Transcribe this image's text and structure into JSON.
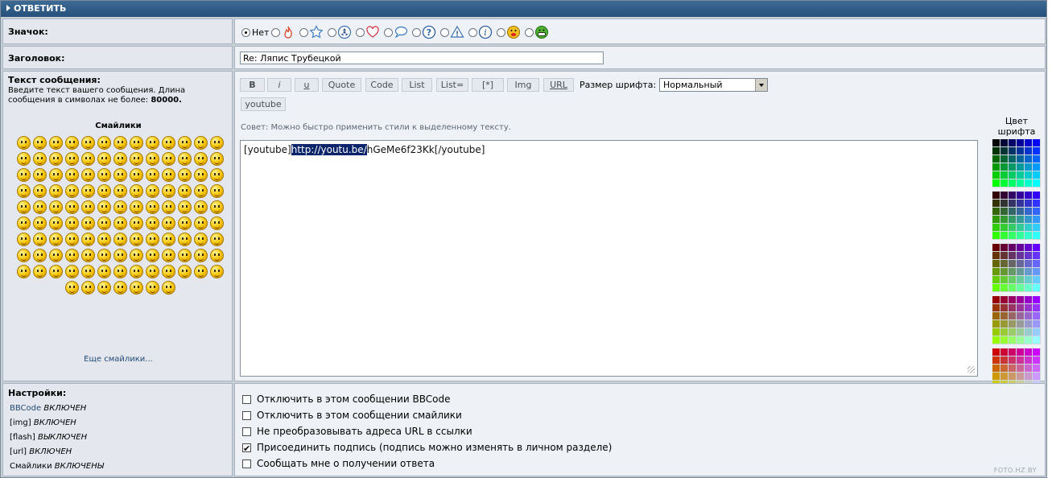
{
  "header": {
    "title": "ОТВЕТИТЬ"
  },
  "icon_row": {
    "label": "Значок:",
    "none_label": "Нет",
    "icons": [
      "fire-icon",
      "star-icon",
      "radioactive-icon",
      "heart-icon",
      "speech-bubble-icon",
      "question-icon",
      "warning-icon",
      "info-icon",
      "tongue-smiley-icon",
      "grin-smiley-icon"
    ]
  },
  "subject": {
    "label": "Заголовок:",
    "value": "Re: Ляпис Трубецкой"
  },
  "message": {
    "label": "Текст сообщения:",
    "hint_line1": "Введите текст вашего сообщения. Длина",
    "hint_line2_prefix": "сообщения в символах не более: ",
    "max_length": "80000.",
    "smilies_title": "Смайлики",
    "more_smilies": "Еще смайлики...",
    "smilies_count": 124,
    "toolbar": {
      "bold": "B",
      "italic": "i",
      "underline": "u",
      "quote": "Quote",
      "code": "Code",
      "list": "List",
      "list_eq": "List=",
      "list_item": "[*]",
      "img": "Img",
      "url": "URL",
      "youtube": "youtube",
      "font_size_label": "Размер шрифта:",
      "font_size_value": "Нормальный"
    },
    "tip": "Совет: Можно быстро применить стили к выделенному тексту.",
    "body_before": "[youtube]",
    "body_selected": "http://youtu.be/",
    "body_after": "hGeMe6f23Kk[/youtube]",
    "font_color_line1": "Цвет",
    "font_color_line2": "шрифта",
    "palette_colors": [
      [
        "#000000",
        "#000033",
        "#000066",
        "#000099",
        "#0000cc",
        "#0000ff"
      ],
      [
        "#003300",
        "#003333",
        "#003366",
        "#003399",
        "#0033cc",
        "#0033ff"
      ],
      [
        "#006600",
        "#006633",
        "#006666",
        "#006699",
        "#0066cc",
        "#0066ff"
      ],
      [
        "#009900",
        "#009933",
        "#009966",
        "#009999",
        "#0099cc",
        "#0099ff"
      ],
      [
        "#00cc00",
        "#00cc33",
        "#00cc66",
        "#00cc99",
        "#00cccc",
        "#00ccff"
      ],
      [
        "#00ff00",
        "#00ff33",
        "#00ff66",
        "#00ff99",
        "#00ffcc",
        "#00ffff"
      ],
      [
        "#330000",
        "#330033",
        "#330066",
        "#330099",
        "#3300cc",
        "#3300ff"
      ],
      [
        "#333300",
        "#333333",
        "#333366",
        "#333399",
        "#3333cc",
        "#3333ff"
      ],
      [
        "#336600",
        "#336633",
        "#336666",
        "#336699",
        "#3366cc",
        "#3366ff"
      ],
      [
        "#339900",
        "#339933",
        "#339966",
        "#339999",
        "#3399cc",
        "#3399ff"
      ],
      [
        "#33cc00",
        "#33cc33",
        "#33cc66",
        "#33cc99",
        "#33cccc",
        "#33ccff"
      ],
      [
        "#33ff00",
        "#33ff33",
        "#33ff66",
        "#33ff99",
        "#33ffcc",
        "#33ffff"
      ],
      [
        "#660000",
        "#660033",
        "#660066",
        "#660099",
        "#6600cc",
        "#6600ff"
      ],
      [
        "#663300",
        "#663333",
        "#663366",
        "#663399",
        "#6633cc",
        "#6633ff"
      ],
      [
        "#666600",
        "#666633",
        "#666666",
        "#666699",
        "#6666cc",
        "#6666ff"
      ],
      [
        "#669900",
        "#669933",
        "#669966",
        "#669999",
        "#6699cc",
        "#6699ff"
      ],
      [
        "#66cc00",
        "#66cc33",
        "#66cc66",
        "#66cc99",
        "#66cccc",
        "#66ccff"
      ],
      [
        "#66ff00",
        "#66ff33",
        "#66ff66",
        "#66ff99",
        "#66ffcc",
        "#66ffff"
      ],
      [
        "#990000",
        "#990033",
        "#990066",
        "#990099",
        "#9900cc",
        "#9900ff"
      ],
      [
        "#993300",
        "#993333",
        "#993366",
        "#993399",
        "#9933cc",
        "#9933ff"
      ],
      [
        "#996600",
        "#996633",
        "#996666",
        "#996699",
        "#9966cc",
        "#9966ff"
      ],
      [
        "#999900",
        "#999933",
        "#999966",
        "#999999",
        "#9999cc",
        "#9999ff"
      ],
      [
        "#99cc00",
        "#99cc33",
        "#99cc66",
        "#99cc99",
        "#99cccc",
        "#99ccff"
      ],
      [
        "#99ff00",
        "#99ff33",
        "#99ff66",
        "#99ff99",
        "#99ffcc",
        "#99ffff"
      ],
      [
        "#cc0000",
        "#cc0033",
        "#cc0066",
        "#cc0099",
        "#cc00cc",
        "#cc00ff"
      ],
      [
        "#cc3300",
        "#cc3333",
        "#cc3366",
        "#cc3399",
        "#cc33cc",
        "#cc33ff"
      ],
      [
        "#cc6600",
        "#cc6633",
        "#cc6666",
        "#cc6699",
        "#cc66cc",
        "#cc66ff"
      ],
      [
        "#cc9900",
        "#cc9933",
        "#cc9966",
        "#cc9999",
        "#cc99cc",
        "#cc99ff"
      ],
      [
        "#cccc00",
        "#cccc33",
        "#cccc66",
        "#cccc99",
        "#cccccc",
        "#ccccff"
      ],
      [
        "#ccff00",
        "#ccff33",
        "#ccff66",
        "#ccff99",
        "#ccffcc",
        "#ccffff"
      ],
      [
        "#ff0000",
        "#ff0033",
        "#ff0066",
        "#ff0099",
        "#ff00cc",
        "#ff00ff"
      ],
      [
        "#ff3300",
        "#ff3333",
        "#ff3366",
        "#ff3399",
        "#ff33cc",
        "#ff33ff"
      ],
      [
        "#ff6600",
        "#ff6633",
        "#ff6666",
        "#ff6699",
        "#ff66cc",
        "#ff66ff"
      ],
      [
        "#ff9900",
        "#ff9933",
        "#ff9966",
        "#ff9999",
        "#ff99cc",
        "#ff99ff"
      ],
      [
        "#ffcc00",
        "#ffcc33",
        "#ffcc66",
        "#ffcc99",
        "#ffcccc",
        "#ffccff"
      ],
      [
        "#ffff00",
        "#ffff33",
        "#ffff66",
        "#ffff99",
        "#ffffcc",
        "#ffffff"
      ]
    ]
  },
  "settings": {
    "label": "Настройки:",
    "items": [
      {
        "name": "BBCode",
        "state": "ВКЛЮЧЕН",
        "link": true
      },
      {
        "name": "[img]",
        "state": "ВКЛЮЧЕН",
        "link": false
      },
      {
        "name": "[flash]",
        "state": "ВЫКЛЮЧЕН",
        "link": false
      },
      {
        "name": "[url]",
        "state": "ВКЛЮЧЕН",
        "link": false
      },
      {
        "name": "Смайлики",
        "state": "ВКЛЮЧЕНЫ",
        "link": false
      }
    ],
    "options": [
      {
        "label": "Отключить в этом сообщении BBCode",
        "checked": false
      },
      {
        "label": "Отключить в этом сообщении смайлики",
        "checked": false
      },
      {
        "label": "Не преобразовывать адреса URL в ссылки",
        "checked": false
      },
      {
        "label": "Присоединить подпись (подпись можно изменять в личном разделе)",
        "checked": true
      },
      {
        "label": "Сообщать мне о получении ответа",
        "checked": false
      }
    ]
  },
  "watermark": "FOTO.HZ.BY"
}
